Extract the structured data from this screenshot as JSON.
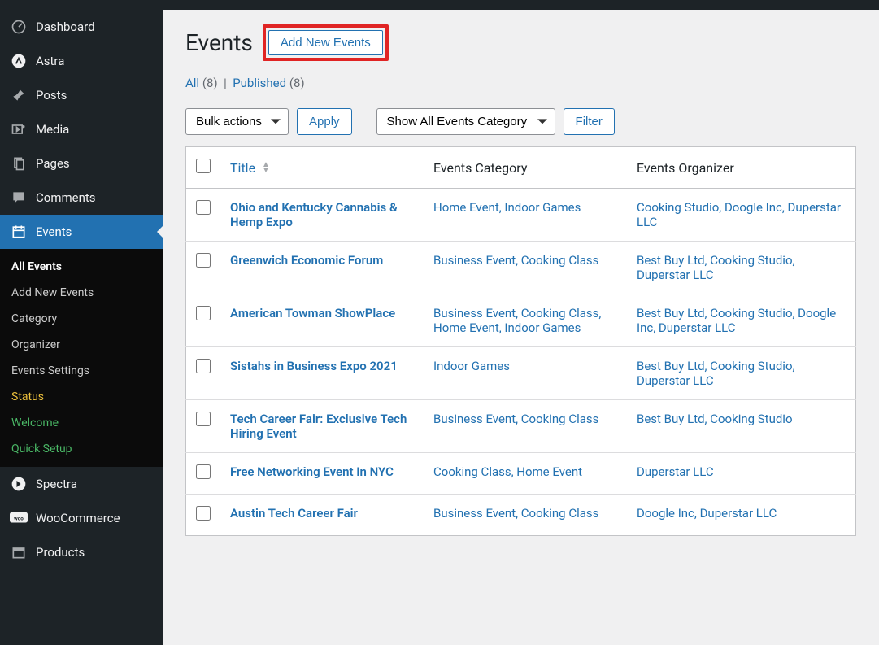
{
  "sidebar": {
    "items": [
      {
        "label": "Dashboard"
      },
      {
        "label": "Astra"
      },
      {
        "label": "Posts"
      },
      {
        "label": "Media"
      },
      {
        "label": "Pages"
      },
      {
        "label": "Comments"
      },
      {
        "label": "Events"
      },
      {
        "label": "Spectra"
      },
      {
        "label": "WooCommerce"
      },
      {
        "label": "Products"
      }
    ],
    "submenu": [
      {
        "label": "All Events"
      },
      {
        "label": "Add New Events"
      },
      {
        "label": "Category"
      },
      {
        "label": "Organizer"
      },
      {
        "label": "Events Settings"
      },
      {
        "label": "Status"
      },
      {
        "label": "Welcome"
      },
      {
        "label": "Quick Setup"
      }
    ]
  },
  "page": {
    "title": "Events",
    "add_new_label": "Add New Events"
  },
  "views": {
    "all_label": "All",
    "all_count": "(8)",
    "sep": "|",
    "published_label": "Published",
    "published_count": "(8)"
  },
  "filters": {
    "bulk_actions": "Bulk actions",
    "apply": "Apply",
    "category_filter": "Show All Events Category",
    "filter": "Filter"
  },
  "columns": {
    "title": "Title",
    "category": "Events Category",
    "organizer": "Events Organizer"
  },
  "rows": [
    {
      "title": "Ohio and Kentucky Cannabis & Hemp Expo",
      "categories": "Home Event, Indoor Games",
      "organizers": "Cooking Studio, Doogle Inc, Duperstar LLC"
    },
    {
      "title": "Greenwich Economic Forum",
      "categories": "Business Event, Cooking Class",
      "organizers": "Best Buy Ltd, Cooking Studio, Duperstar LLC"
    },
    {
      "title": "American Towman ShowPlace",
      "categories": "Business Event, Cooking Class, Home Event, Indoor Games",
      "organizers": "Best Buy Ltd, Cooking Studio, Doogle Inc, Duperstar LLC"
    },
    {
      "title": "Sistahs in Business Expo 2021",
      "categories": "Indoor Games",
      "organizers": "Best Buy Ltd, Cooking Studio, Duperstar LLC"
    },
    {
      "title": "Tech Career Fair: Exclusive Tech Hiring Event",
      "categories": "Business Event, Cooking Class",
      "organizers": "Best Buy Ltd, Cooking Studio"
    },
    {
      "title": "Free Networking Event In NYC",
      "categories": "Cooking Class, Home Event",
      "organizers": "Duperstar LLC"
    },
    {
      "title": "Austin Tech Career Fair",
      "categories": "Business Event, Cooking Class",
      "organizers": "Doogle Inc, Duperstar LLC"
    }
  ]
}
